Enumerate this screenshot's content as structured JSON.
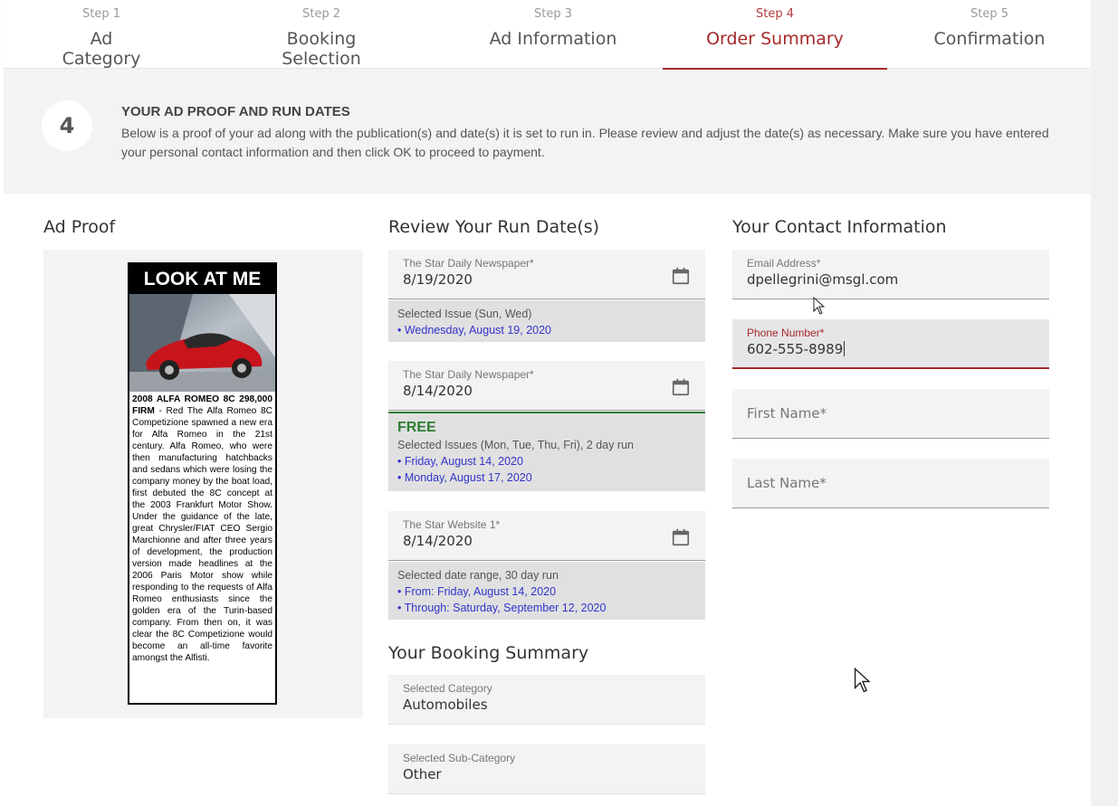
{
  "stepper": {
    "steps": [
      {
        "num": "Step 1",
        "title": "Ad Category"
      },
      {
        "num": "Step 2",
        "title": "Booking Selection"
      },
      {
        "num": "Step 3",
        "title": "Ad Information"
      },
      {
        "num": "Step 4",
        "title": "Order Summary"
      },
      {
        "num": "Step 5",
        "title": "Confirmation"
      }
    ],
    "active_index": 3
  },
  "info": {
    "step_number": "4",
    "title": "YOUR AD PROOF AND RUN DATES",
    "description": "Below is a proof of your ad along with the publication(s) and date(s) it is set to run in. Please review and adjust the date(s) as necessary. Make sure you have entered your personal contact information and then click OK to proceed to payment."
  },
  "ad_proof": {
    "heading": "Ad Proof",
    "ad_header": "LOOK AT ME",
    "ad_bold": "2008 ALFA ROMEO 8C 298,000 FIRM",
    "ad_body": " - Red The Alfa Romeo 8C Competizione spawned a new era for Alfa Romeo in the 21st century. Alfa Romeo, who were then manufacturing hatchbacks and sedans which were losing the company money by the boat load, first debuted the 8C concept at the 2003 Frankfurt Motor Show. Under the guidance of the late, great Chrysler/FIAT CEO Sergio Marchionne and after three years of development, the production version made headlines at the 2006 Paris Motor show while responding to the requests of Alfa Romeo enthusiasts since the golden era of the Turin-based company. From then on, it was clear the 8C Competizione would become an all-time favorite amongst the Alfisti."
  },
  "run_dates": {
    "heading": "Review Your Run Date(s)",
    "entries": [
      {
        "label": "The Star Daily Newspaper*",
        "value": "8/19/2020",
        "free": "",
        "summary": "Selected Issue (Sun, Wed)",
        "dates": [
          "• Wednesday, August 19, 2020"
        ]
      },
      {
        "label": "The Star Daily Newspaper*",
        "value": "8/14/2020",
        "free": "FREE",
        "summary": "Selected Issues (Mon, Tue, Thu, Fri), 2 day run",
        "dates": [
          "• Friday, August 14, 2020",
          "• Monday, August 17, 2020"
        ]
      },
      {
        "label": "The Star Website 1*",
        "value": "8/14/2020",
        "free": "",
        "summary": "Selected date range, 30 day run",
        "dates": [
          "• From: Friday, August 14, 2020",
          "• Through: Saturday, September 12, 2020"
        ]
      }
    ]
  },
  "booking_summary": {
    "heading": "Your Booking Summary",
    "category_label": "Selected Category",
    "category_value": "Automobiles",
    "subcategory_label": "Selected Sub-Category",
    "subcategory_value": "Other"
  },
  "contact": {
    "heading": "Your Contact Information",
    "email_label": "Email Address*",
    "email_value": "dpellegrini@msgl.com",
    "phone_label": "Phone Number*",
    "phone_value": "602-555-8989",
    "first_name_placeholder": "First Name*",
    "last_name_placeholder": "Last Name*"
  },
  "colors": {
    "accent": "#a52a2a",
    "free_green": "#2e7d32",
    "link_blue": "#3333cc"
  }
}
